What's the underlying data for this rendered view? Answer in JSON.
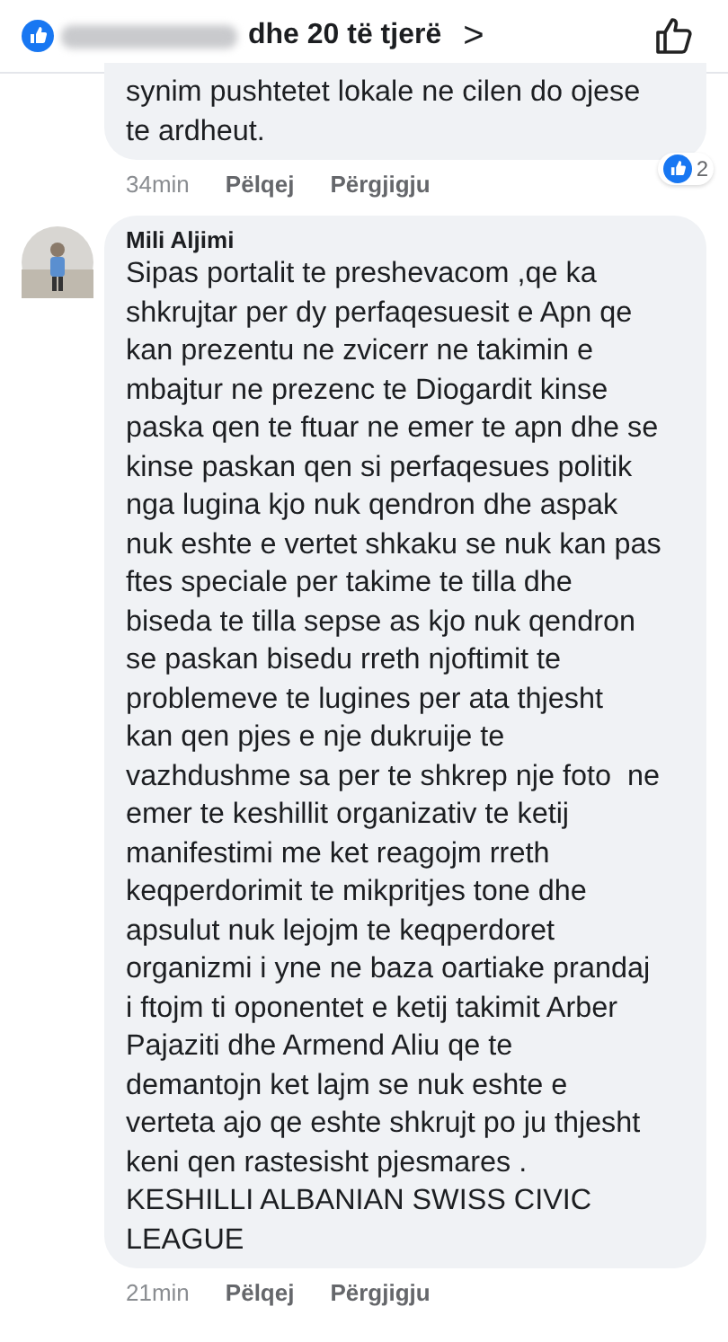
{
  "header": {
    "reactors_text": "dhe 20 të tjerë",
    "chevron": ">"
  },
  "comments": [
    {
      "text": "synim pushtetet lokale ne cilen do ojese\nte ardheut.",
      "time": "34min",
      "actions": [
        "Pëlqej",
        "Përgjigju"
      ],
      "reactions": "2"
    },
    {
      "author": "Mili Aljimi",
      "text": "Sipas portalit te preshevacom ,qe ka\nshkrujtar per dy perfaqesuesit e Apn qe\nkan prezentu ne zvicerr ne takimin e\nmbajtur ne prezenc te Diogardit kinse\npaska qen te ftuar ne emer te apn dhe se\nkinse paskan qen si perfaqesues politik\nnga lugina kjo nuk qendron dhe aspak\nnuk eshte e vertet shkaku se nuk kan pas\nftes speciale per takime te tilla dhe\nbiseda te tilla sepse as kjo nuk qendron\nse paskan bisedu rreth njoftimit te\nproblemeve te lugines per ata thjesht\nkan qen pjes e nje dukruije te\nvazhdushme sa per te shkrep nje foto  ne\nemer te keshillit organizativ te ketij\nmanifestimi me ket reagojm rreth\nkeqperdorimit te mikpritjes tone dhe\napsulut nuk lejojm te keqperdoret\norganizmi i yne ne baza oartiake prandaj\ni ftojm ti oponentet e ketij takimit Arber\nPajaziti dhe Armend Aliu qe te\ndemantojn ket lajm se nuk eshte e\nverteta ajo qe eshte shkrujt po ju thjesht\nkeni qen rastesisht pjesmares .\nKESHILLI ALBANIAN SWISS CIVIC\nLEAGUE",
      "time": "21min",
      "actions": [
        "Pëlqej",
        "Përgjigju"
      ]
    }
  ]
}
